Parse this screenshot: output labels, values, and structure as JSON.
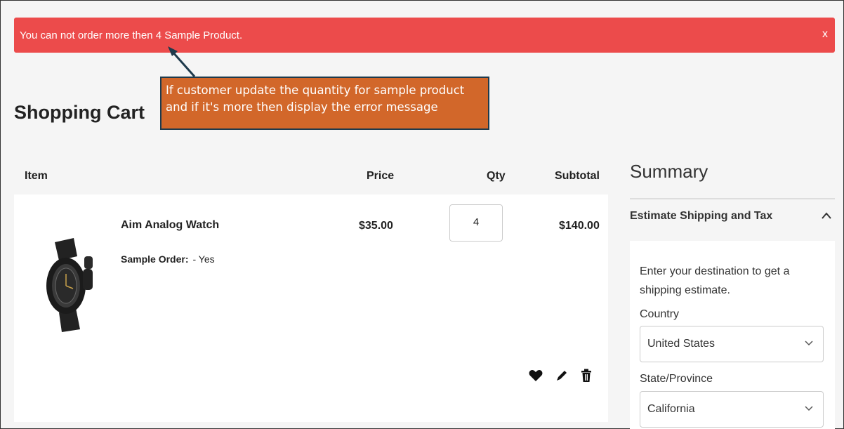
{
  "alert": {
    "message": "You can not order more then 4 Sample Product.",
    "close_label": "x"
  },
  "callout": {
    "line1": "If customer update the quantity for sample product",
    "line2": "and if it's more then display the error message"
  },
  "page": {
    "title": "Shopping Cart"
  },
  "cart": {
    "headers": {
      "item": "Item",
      "price": "Price",
      "qty": "Qty",
      "subtotal": "Subtotal"
    },
    "items": [
      {
        "name": "Aim Analog Watch",
        "option_label": "Sample Order:",
        "option_value": "- Yes",
        "price": "$35.00",
        "qty": "4",
        "subtotal": "$140.00"
      }
    ],
    "action_icons": [
      "heart-icon",
      "pencil-icon",
      "trash-icon"
    ]
  },
  "summary": {
    "title": "Summary",
    "estimate_title": "Estimate Shipping and Tax",
    "intro": "Enter your destination to get a shipping estimate.",
    "country_label": "Country",
    "country_value": "United States",
    "state_label": "State/Province",
    "state_value": "California"
  },
  "colors": {
    "alert_bg": "#ec4b4b",
    "callout_bg": "#d2672a",
    "callout_border": "#1e3a4c"
  }
}
